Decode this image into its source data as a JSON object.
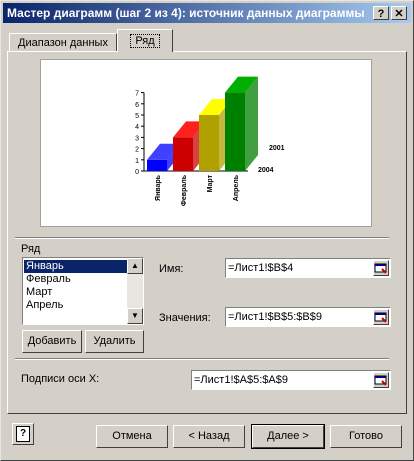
{
  "window": {
    "title": "Мастер диаграмм (шаг 2 из 4): источник данных диаграммы",
    "help_glyph": "?",
    "close_glyph": "✕"
  },
  "tabs": [
    {
      "label": "Диапазон данных",
      "active": false
    },
    {
      "label": "Ряд",
      "active": true
    }
  ],
  "chart_data": {
    "type": "bar",
    "categories": [
      "Январь",
      "Февраль",
      "Март",
      "Апрель"
    ],
    "values": [
      1,
      3,
      5,
      7
    ],
    "colors": [
      "#0000ff",
      "#cc0000",
      "#b0a000",
      "#008000"
    ],
    "top_colors": [
      "#4040ff",
      "#ff2020",
      "#ffff00",
      "#00b000"
    ],
    "ylim": [
      0,
      7
    ],
    "yticks": [
      "0",
      "1",
      "2",
      "3",
      "4",
      "5",
      "6",
      "7"
    ],
    "depth_labels": [
      "2001",
      "2004"
    ]
  },
  "series": {
    "group_label": "Ряд",
    "items": [
      "Январь",
      "Февраль",
      "Март",
      "Апрель"
    ],
    "selected_index": 0,
    "add_button": "Добавить",
    "remove_button": "Удалить",
    "name_label": "Имя:",
    "name_value": "=Лист1!$B$4",
    "values_label": "Значения:",
    "values_value": "=Лист1!$B$5:$B$9"
  },
  "axis": {
    "label": "Подписи оси X:",
    "value": "=Лист1!$A$5:$A$9"
  },
  "footer": {
    "help_icon_glyph": "?",
    "cancel": "Отмена",
    "back": "< Назад",
    "next": "Далее >",
    "finish": "Готово"
  }
}
